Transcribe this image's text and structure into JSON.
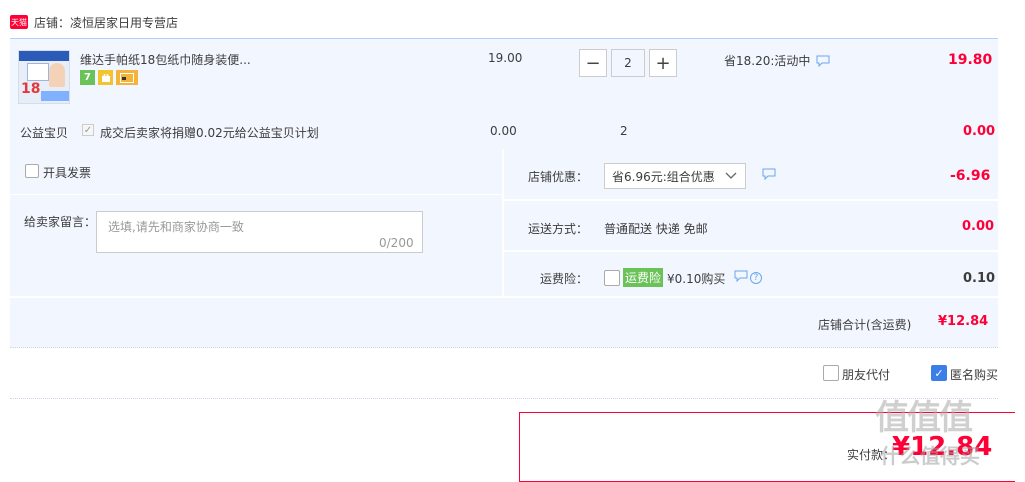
{
  "shop": {
    "label": "店铺：",
    "name": "凌恒居家日用专营店",
    "badge": "天猫"
  },
  "item": {
    "title": "维达手帕纸18包纸巾随身装便...",
    "price": "19.00",
    "quantity": "2",
    "minus_label": "−",
    "plus_label": "+",
    "promo": "省18.20:活动中",
    "total": "19.80",
    "thumb_number": "18",
    "service_icons": [
      "7-days-return-icon",
      "android-icon",
      "credit-card-icon"
    ]
  },
  "charity": {
    "label": "公益宝贝",
    "text": "成交后卖家将捐赠0.02元给公益宝贝计划",
    "price": "0.00",
    "quantity": "2",
    "total": "0.00"
  },
  "invoice": {
    "label": "开具发票"
  },
  "message": {
    "label": "给卖家留言：",
    "placeholder": "选填,请先和商家协商一致",
    "counter": "0/200"
  },
  "discount": {
    "label": "店铺优惠：",
    "selected": "省6.96元:组合优惠",
    "amount": "-6.96"
  },
  "shipping": {
    "label": "运送方式：",
    "value": "普通配送 快递 免邮",
    "amount": "0.00"
  },
  "insurance": {
    "label": "运费险：",
    "badge": "运费险",
    "price": "¥0.10购买",
    "amount": "0.10"
  },
  "shop_total": {
    "label": "店铺合计(含运费)",
    "value": "¥12.84"
  },
  "options": {
    "friend_pay": "朋友代付",
    "anonymous": "匿名购买",
    "anonymous_checked": true
  },
  "payment": {
    "label": "实付款：",
    "amount": "¥12.84"
  },
  "watermark": {
    "text": "值值值",
    "sub": "什么值得买"
  },
  "colors": {
    "accent": "#ff0036",
    "panel": "#f2f7ff",
    "check_blue": "#3b7de9",
    "insurance_green": "#6ac259"
  }
}
